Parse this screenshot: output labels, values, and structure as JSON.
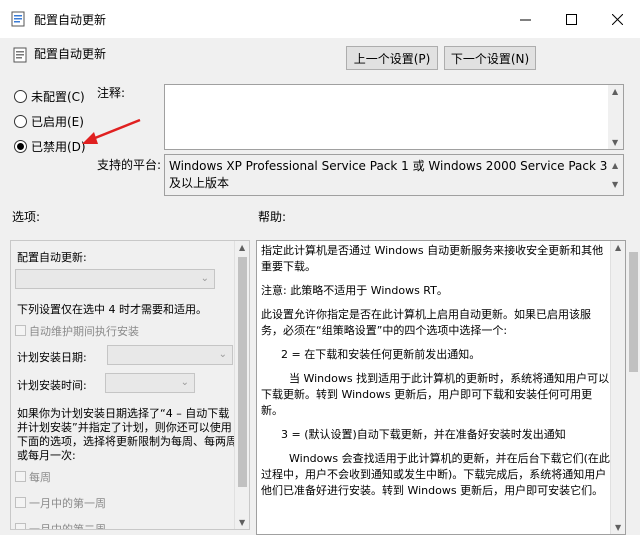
{
  "window": {
    "title": "配置自动更新",
    "controls": {
      "minimize": "—",
      "maximize": "☐",
      "close": "✕"
    }
  },
  "header": {
    "title": "配置自动更新",
    "prev_button": "上一个设置(P)",
    "next_button": "下一个设置(N)"
  },
  "state": {
    "radios": [
      {
        "label": "未配置(C)",
        "checked": false
      },
      {
        "label": "已启用(E)",
        "checked": false
      },
      {
        "label": "已禁用(D)",
        "checked": true
      }
    ],
    "comment_label": "注释:",
    "comment_value": "",
    "platform_label": "支持的平台:",
    "platform_value": "Windows XP Professional Service Pack 1 或 Windows 2000 Service Pack 3 及以上版本"
  },
  "options": {
    "section_label": "选项:",
    "configure_label": "配置自动更新:",
    "configure_value": "",
    "note": "下列设置仅在选中 4 时才需要和适用。",
    "maintenance_checkbox": "自动维护期间执行安装",
    "schedule_day_label": "计划安装日期:",
    "schedule_time_label": "计划安装时间:",
    "paragraph": [
      "如果你为计划安装日期选择了“4 – 自动下载",
      "并计划安装”并指定了计划，则你还可以使用",
      "下面的选项，选择将更新限制为每周、每两周",
      "或每月一次:"
    ],
    "weekly_checkbox": "每周",
    "first_week_checkbox": "一月中的第一周",
    "second_week_checkbox": "一月中的第二周"
  },
  "help": {
    "section_label": "帮助:",
    "paragraphs": [
      "指定此计算机是否通过 Windows 自动更新服务来接收安全更新和其他重要下载。",
      "注意: 此策略不适用于 Windows RT。",
      "此设置允许你指定是否在此计算机上启用自动更新。如果已启用该服务，必须在“组策略设置”中的四个选项中选择一个:",
      "2 = 在下载和安装任何更新前发出通知。",
      "当 Windows 找到适用于此计算机的更新时，系统将通知用户可以下载更新。转到 Windows 更新后，用户即可下载和安装任何可用更新。",
      "3 = (默认设置)自动下载更新，并在准备好安装时发出通知",
      "Windows 会查找适用于此计算机的更新，并在后台下载它们(在此过程中，用户不会收到通知或发生中断)。下载完成后，系统将通知用户他们已准备好进行安装。转到 Windows 更新后，用户即可安装它们。"
    ]
  },
  "colors": {
    "annotation_arrow": "#e02020",
    "background": "#f0f0f0"
  }
}
